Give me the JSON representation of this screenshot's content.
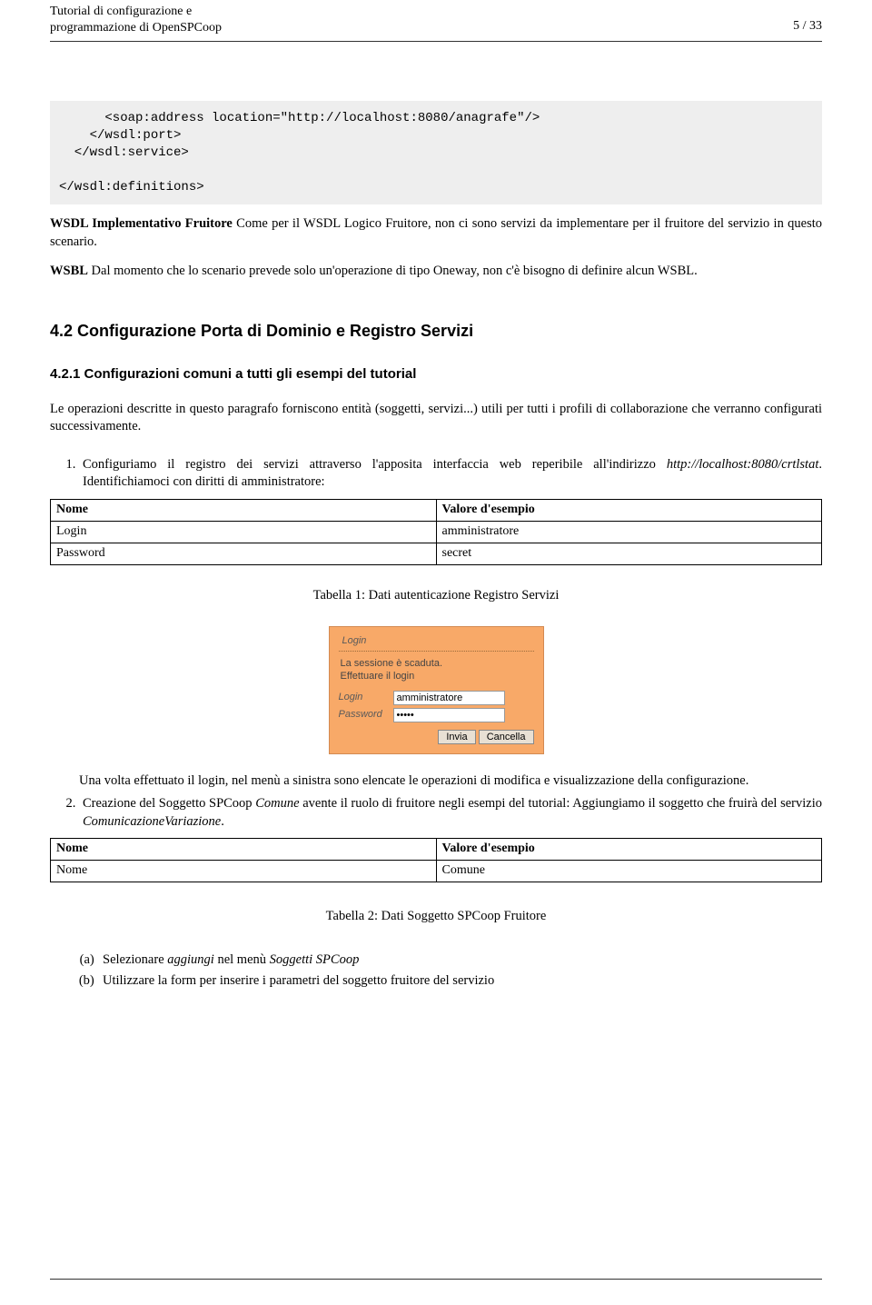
{
  "header": {
    "title_line1": "Tutorial di configurazione e",
    "title_line2": "programmazione di OpenSPCoop",
    "page": "5 / 33"
  },
  "codeblock": "      <soap:address location=\"http://localhost:8080/anagrafe\"/>\n    </wsdl:port>\n  </wsdl:service>\n\n</wsdl:definitions>",
  "p_wsdl_label": "WSDL Implementativo Fruitore",
  "p_wsdl_text": " Come per il WSDL Logico Fruitore, non ci sono servizi da implementare per il fruitore del servizio in questo scenario.",
  "p_wsbl_label": "WSBL",
  "p_wsbl_text": " Dal momento che lo scenario prevede solo un'operazione di tipo Oneway, non c'è bisogno di definire alcun WSBL.",
  "section42": "4.2   Configurazione Porta di Dominio e Registro Servizi",
  "section421": "4.2.1   Configurazioni comuni a tutti gli esempi del tutorial",
  "p_intro": "Le operazioni descritte in questo paragrafo forniscono entità (soggetti, servizi...) utili per tutti i profili di collaborazione che verranno configurati successivamente.",
  "step1_text_a": "Configuriamo il registro dei servizi attraverso l'apposita interfaccia web reperibile all'indirizzo ",
  "step1_url": "http://localhost:8080/crtlstat",
  "step1_text_b": ". Identifichiamoci con diritti di amministratore:",
  "table1": {
    "header": [
      "Nome",
      "Valore d'esempio"
    ],
    "rows": [
      [
        "Login",
        "amministratore"
      ],
      [
        "Password",
        "secret"
      ]
    ]
  },
  "table1_caption": "Tabella 1: Dati autenticazione Registro Servizi",
  "login": {
    "title": "Login",
    "msg_line1": "La sessione è scaduta.",
    "msg_line2": "Effettuare il login",
    "login_label": "Login",
    "password_label": "Password",
    "login_value": "amministratore",
    "password_value": "•••••",
    "btn_submit": "Invia",
    "btn_cancel": "Cancella"
  },
  "after_login": "Una volta effettuato il login, nel menù a sinistra sono elencate le operazioni di modifica e visualizzazione della configurazione.",
  "step2_text_a": "Creazione del Soggetto SPCoop ",
  "step2_italic1": "Comune",
  "step2_text_b": " avente il ruolo di fruitore negli esempi del tutorial: Aggiungiamo il soggetto che fruirà del servizio ",
  "step2_italic2": "ComunicazioneVariazione",
  "step2_text_c": ".",
  "table2": {
    "header": [
      "Nome",
      "Valore d'esempio"
    ],
    "rows": [
      [
        "Nome",
        "Comune"
      ]
    ]
  },
  "table2_caption": "Tabella 2: Dati Soggetto SPCoop Fruitore",
  "sub_a_1": "Selezionare ",
  "sub_a_i1": "aggiungi",
  "sub_a_2": " nel menù ",
  "sub_a_i2": "Soggetti SPCoop",
  "sub_b": "Utilizzare la form per inserire i parametri del soggetto fruitore del servizio"
}
